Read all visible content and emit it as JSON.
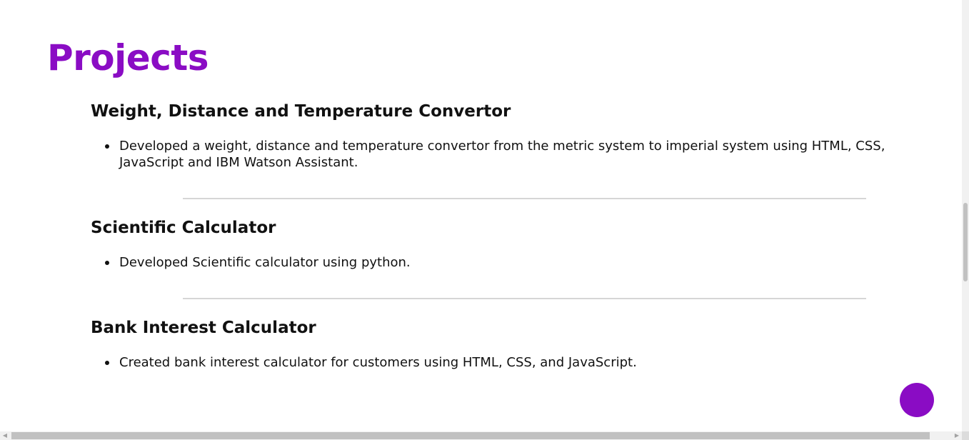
{
  "section": {
    "title": "Projects"
  },
  "projects": [
    {
      "title": "Weight, Distance and Temperature Convertor",
      "bullets": [
        "Developed a weight, distance and temperature convertor from the metric system to imperial system using HTML, CSS, JavaScript and IBM Watson Assistant."
      ]
    },
    {
      "title": "Scientific Calculator",
      "bullets": [
        "Developed Scientific calculator using python."
      ]
    },
    {
      "title": "Bank Interest Calculator",
      "bullets": [
        "Created bank interest calculator for customers using HTML, CSS, and JavaScript."
      ]
    }
  ],
  "fab": {
    "icon": "circle-button-icon",
    "color": "#8a0cc4"
  },
  "theme": {
    "accent": "#8a0cc4",
    "divider": "#d6d6d6"
  },
  "scrollbars": {
    "left_arrow": "◀",
    "right_arrow": "▶"
  }
}
